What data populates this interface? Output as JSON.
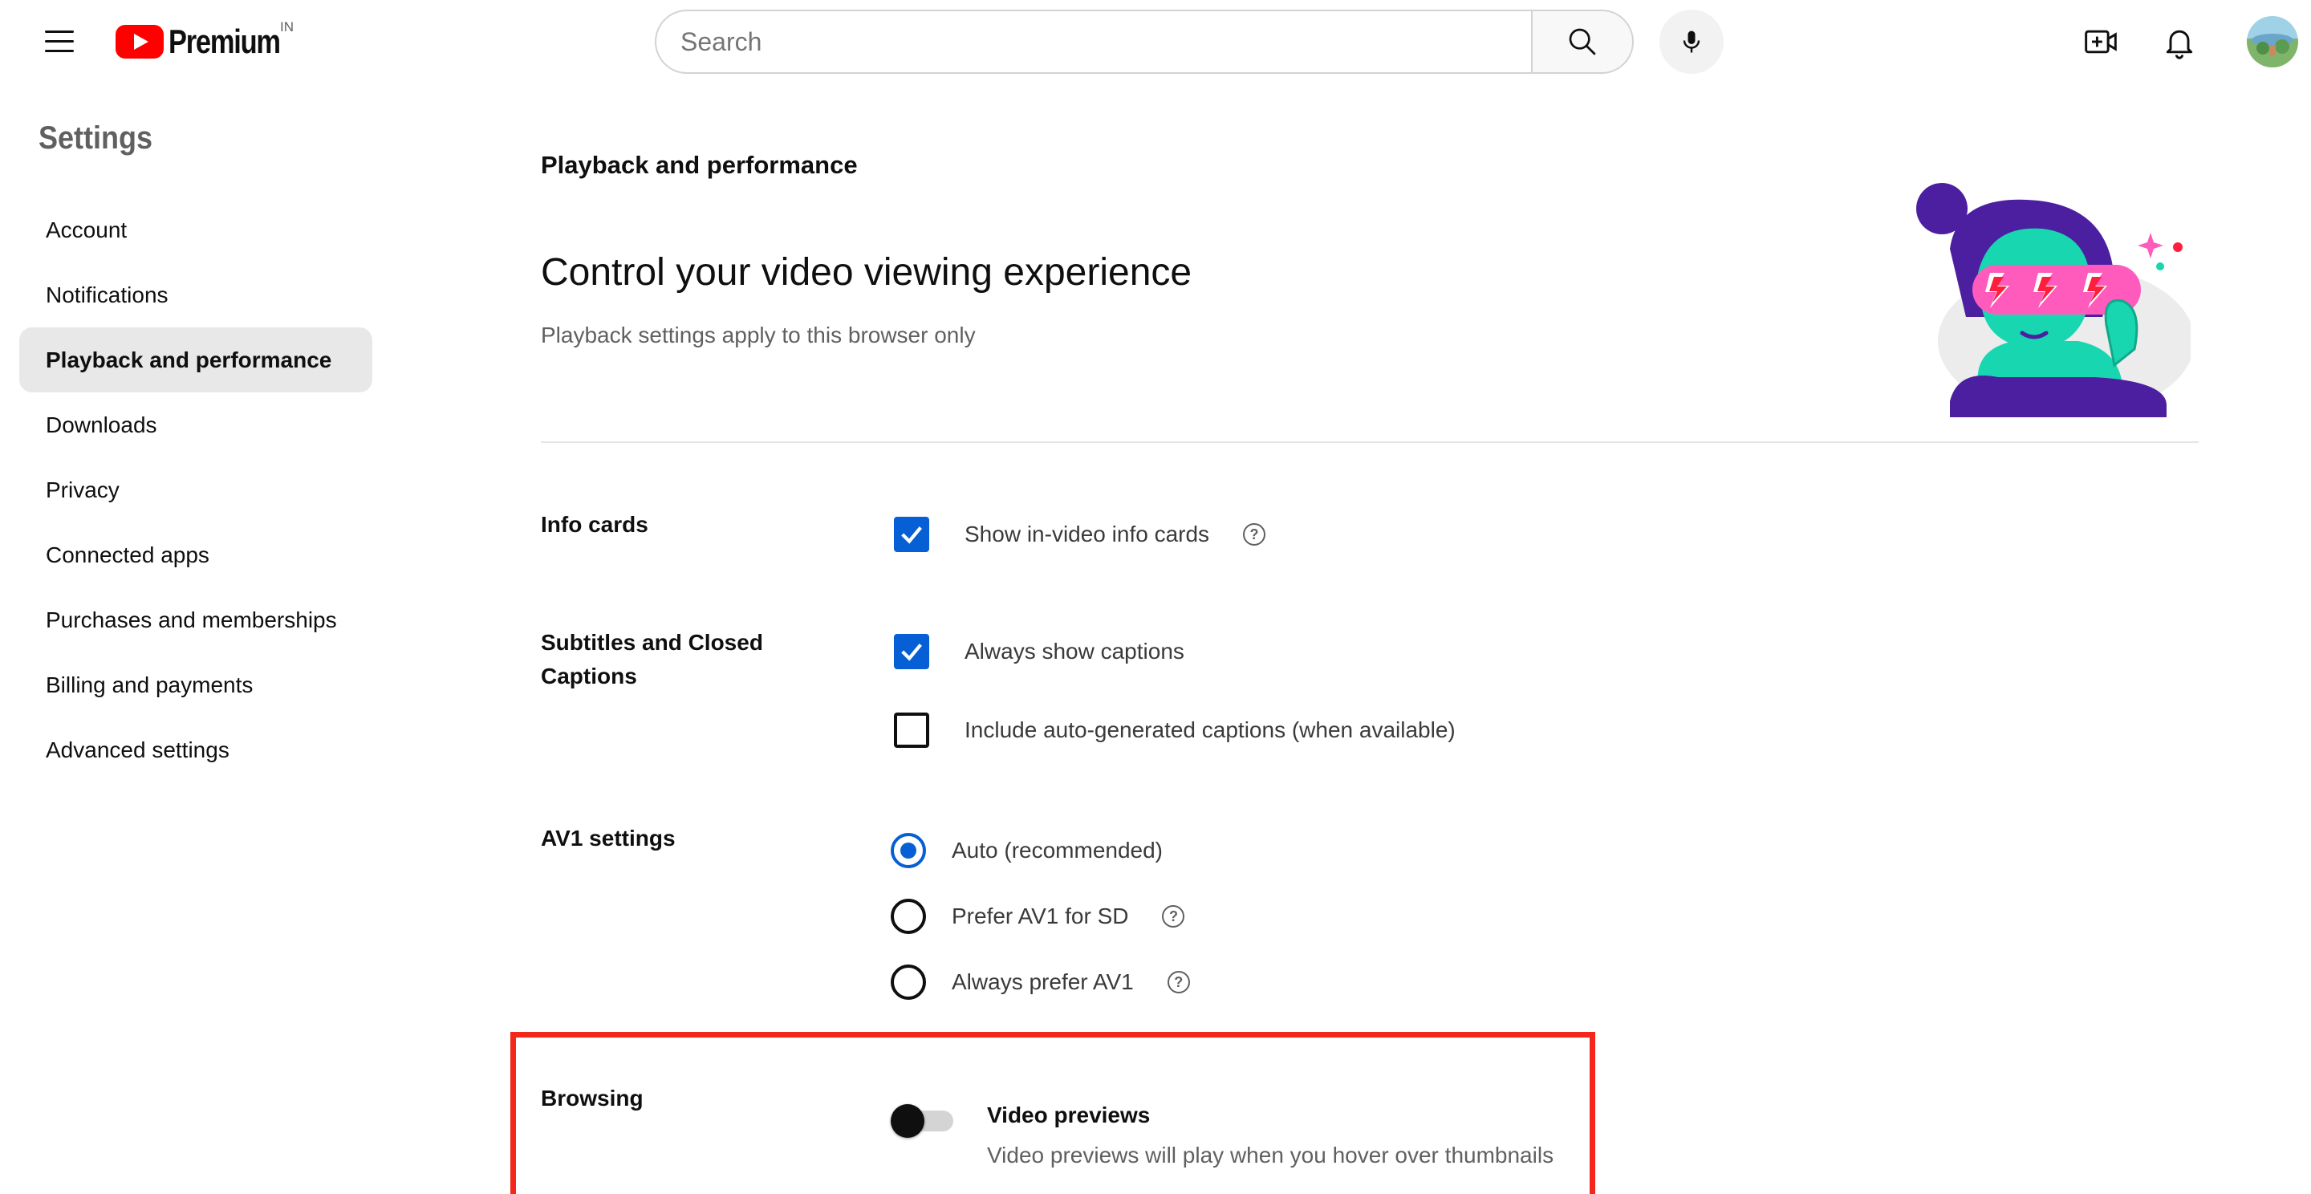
{
  "header": {
    "brand": "Premium",
    "country_code": "IN",
    "search": {
      "placeholder": "Search",
      "value": ""
    },
    "icons": [
      "menu-icon",
      "youtube-logo-icon",
      "search-icon",
      "mic-icon",
      "create-video-icon",
      "bell-icon",
      "avatar"
    ]
  },
  "sidebar": {
    "title": "Settings",
    "items": [
      {
        "label": "Account"
      },
      {
        "label": "Notifications"
      },
      {
        "label": "Playback and performance",
        "active": true
      },
      {
        "label": "Downloads"
      },
      {
        "label": "Privacy"
      },
      {
        "label": "Connected apps"
      },
      {
        "label": "Purchases and memberships"
      },
      {
        "label": "Billing and payments"
      },
      {
        "label": "Advanced settings"
      }
    ]
  },
  "main": {
    "section_heading": "Playback and performance",
    "title": "Control your video viewing experience",
    "subtitle": "Playback settings apply to this browser only",
    "info_cards": {
      "label": "Info cards",
      "options": [
        {
          "label": "Show in-video info cards",
          "checked": true,
          "help": "?"
        }
      ]
    },
    "captions": {
      "label": "Subtitles and Closed Captions",
      "options": [
        {
          "label": "Always show captions",
          "checked": true
        },
        {
          "label": "Include auto-generated captions (when available)",
          "checked": false
        }
      ]
    },
    "av1": {
      "label": "AV1 settings",
      "options": [
        {
          "label": "Auto (recommended)",
          "selected": true
        },
        {
          "label": "Prefer AV1 for SD",
          "selected": false,
          "help": "?"
        },
        {
          "label": "Always prefer AV1",
          "selected": false,
          "help": "?"
        }
      ]
    },
    "browsing": {
      "label": "Browsing",
      "toggle_title": "Video previews",
      "toggle_description": "Video previews will play when you hover over thumbnails",
      "enabled": false
    }
  },
  "colors": {
    "accent_blue": "#065fd4",
    "youtube_red": "#ff0000",
    "highlight_red": "#f3271b",
    "muted_text": "#606060"
  }
}
